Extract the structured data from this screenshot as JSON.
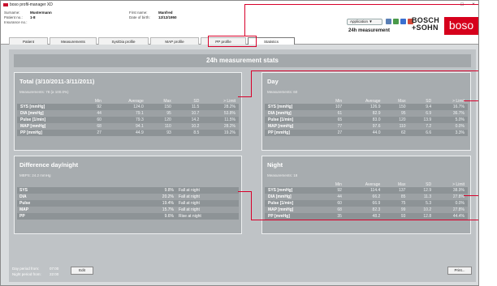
{
  "window": {
    "title": "boso profil-manager XD",
    "minimize": "–",
    "maximize": "□",
    "close": "×"
  },
  "patient": {
    "surname_label": "Surname:",
    "surname": "Mustermann",
    "patient_no_label": "Patient no.:",
    "patient_no": "1-8",
    "insurance_no_label": "Insurance no.:",
    "first_name_label": "First name:",
    "first_name": "Manfred",
    "dob_label": "Date of birth:",
    "dob": "12/12/1950"
  },
  "header": {
    "application_menu": "Application ▼",
    "measurement_title": "24h measurement",
    "bosch_logo": "BOSCH +SOHN",
    "boso_logo": "boso"
  },
  "tabs": [
    "Patient",
    "Measurements",
    "Sys/Dia profile",
    "MAP profile",
    "PP profile",
    "Statistics"
  ],
  "main": {
    "banner": "24h measurement stats"
  },
  "columns": [
    "",
    "Min",
    "Average",
    "Max",
    "SD",
    "> Limit"
  ],
  "total": {
    "title": "Total (3/10/2011-3/11/2011)",
    "subtitle": "Measurements: 78 (≥ 100.0%)",
    "rows": [
      [
        "SYS [mmHg]",
        "92",
        "124.0",
        "150",
        "11.5",
        "28.2%"
      ],
      [
        "DIA [mmHg]",
        "44",
        "79.1",
        "95",
        "10.7",
        "53.8%"
      ],
      [
        "Pulse [1/min]",
        "60",
        "79.3",
        "120",
        "14.2",
        "11.5%"
      ],
      [
        "MAP [mmHg]",
        "68",
        "94.1",
        "110",
        "10.2",
        "28.2%"
      ],
      [
        "PP [mmHg]",
        "27",
        "44.9",
        "93",
        "8.5",
        "19.2%"
      ]
    ]
  },
  "day": {
    "title": "Day",
    "subtitle": "Measurements: 60",
    "rows": [
      [
        "SYS [mmHg]",
        "107",
        "126.9",
        "150",
        "9.4",
        "16.7%"
      ],
      [
        "DIA [mmHg]",
        "61",
        "82.9",
        "95",
        "6.9",
        "36.7%"
      ],
      [
        "Pulse [1/min]",
        "65",
        "83.0",
        "120",
        "13.9",
        "5.0%"
      ],
      [
        "MAP [mmHg]",
        "77",
        "97.6",
        "110",
        "7.2",
        "0.0%"
      ],
      [
        "PP [mmHg]",
        "27",
        "44.0",
        "62",
        "6.6",
        "3.3%"
      ]
    ]
  },
  "night": {
    "title": "Night",
    "subtitle": "Measurements: 18",
    "rows": [
      [
        "SYS [mmHg]",
        "92",
        "114.4",
        "137",
        "12.9",
        "38.9%"
      ],
      [
        "DIA [mmHg]",
        "44",
        "66.2",
        "85",
        "11.3",
        "27.8%"
      ],
      [
        "Pulse [1/min]",
        "60",
        "66.9",
        "75",
        "5.3",
        "0.0%"
      ],
      [
        "MAP [mmHg]",
        "68",
        "82.3",
        "99",
        "10.2",
        "27.8%"
      ],
      [
        "PP [mmHg]",
        "35",
        "48.2",
        "93",
        "12.8",
        "44.4%"
      ]
    ]
  },
  "daynight": {
    "title": "Difference day/night",
    "subtitle": "MBPS: 24.2 mmHg",
    "rows": [
      [
        "SYS",
        "9.8%",
        "Fall at night"
      ],
      [
        "DIA",
        "20.2%",
        "Fall at night"
      ],
      [
        "Pulse",
        "19.4%",
        "Fall at night"
      ],
      [
        "MAP",
        "15.7%",
        "Fall at night"
      ],
      [
        "PP",
        "9.6%",
        "Rise at night"
      ]
    ]
  },
  "footer": {
    "day_period_label": "Day period from:",
    "day_period": "07:00",
    "night_period_label": "Night period from:",
    "night_period": "22:00",
    "edit_button": "Edit",
    "print_button": "Print..."
  }
}
